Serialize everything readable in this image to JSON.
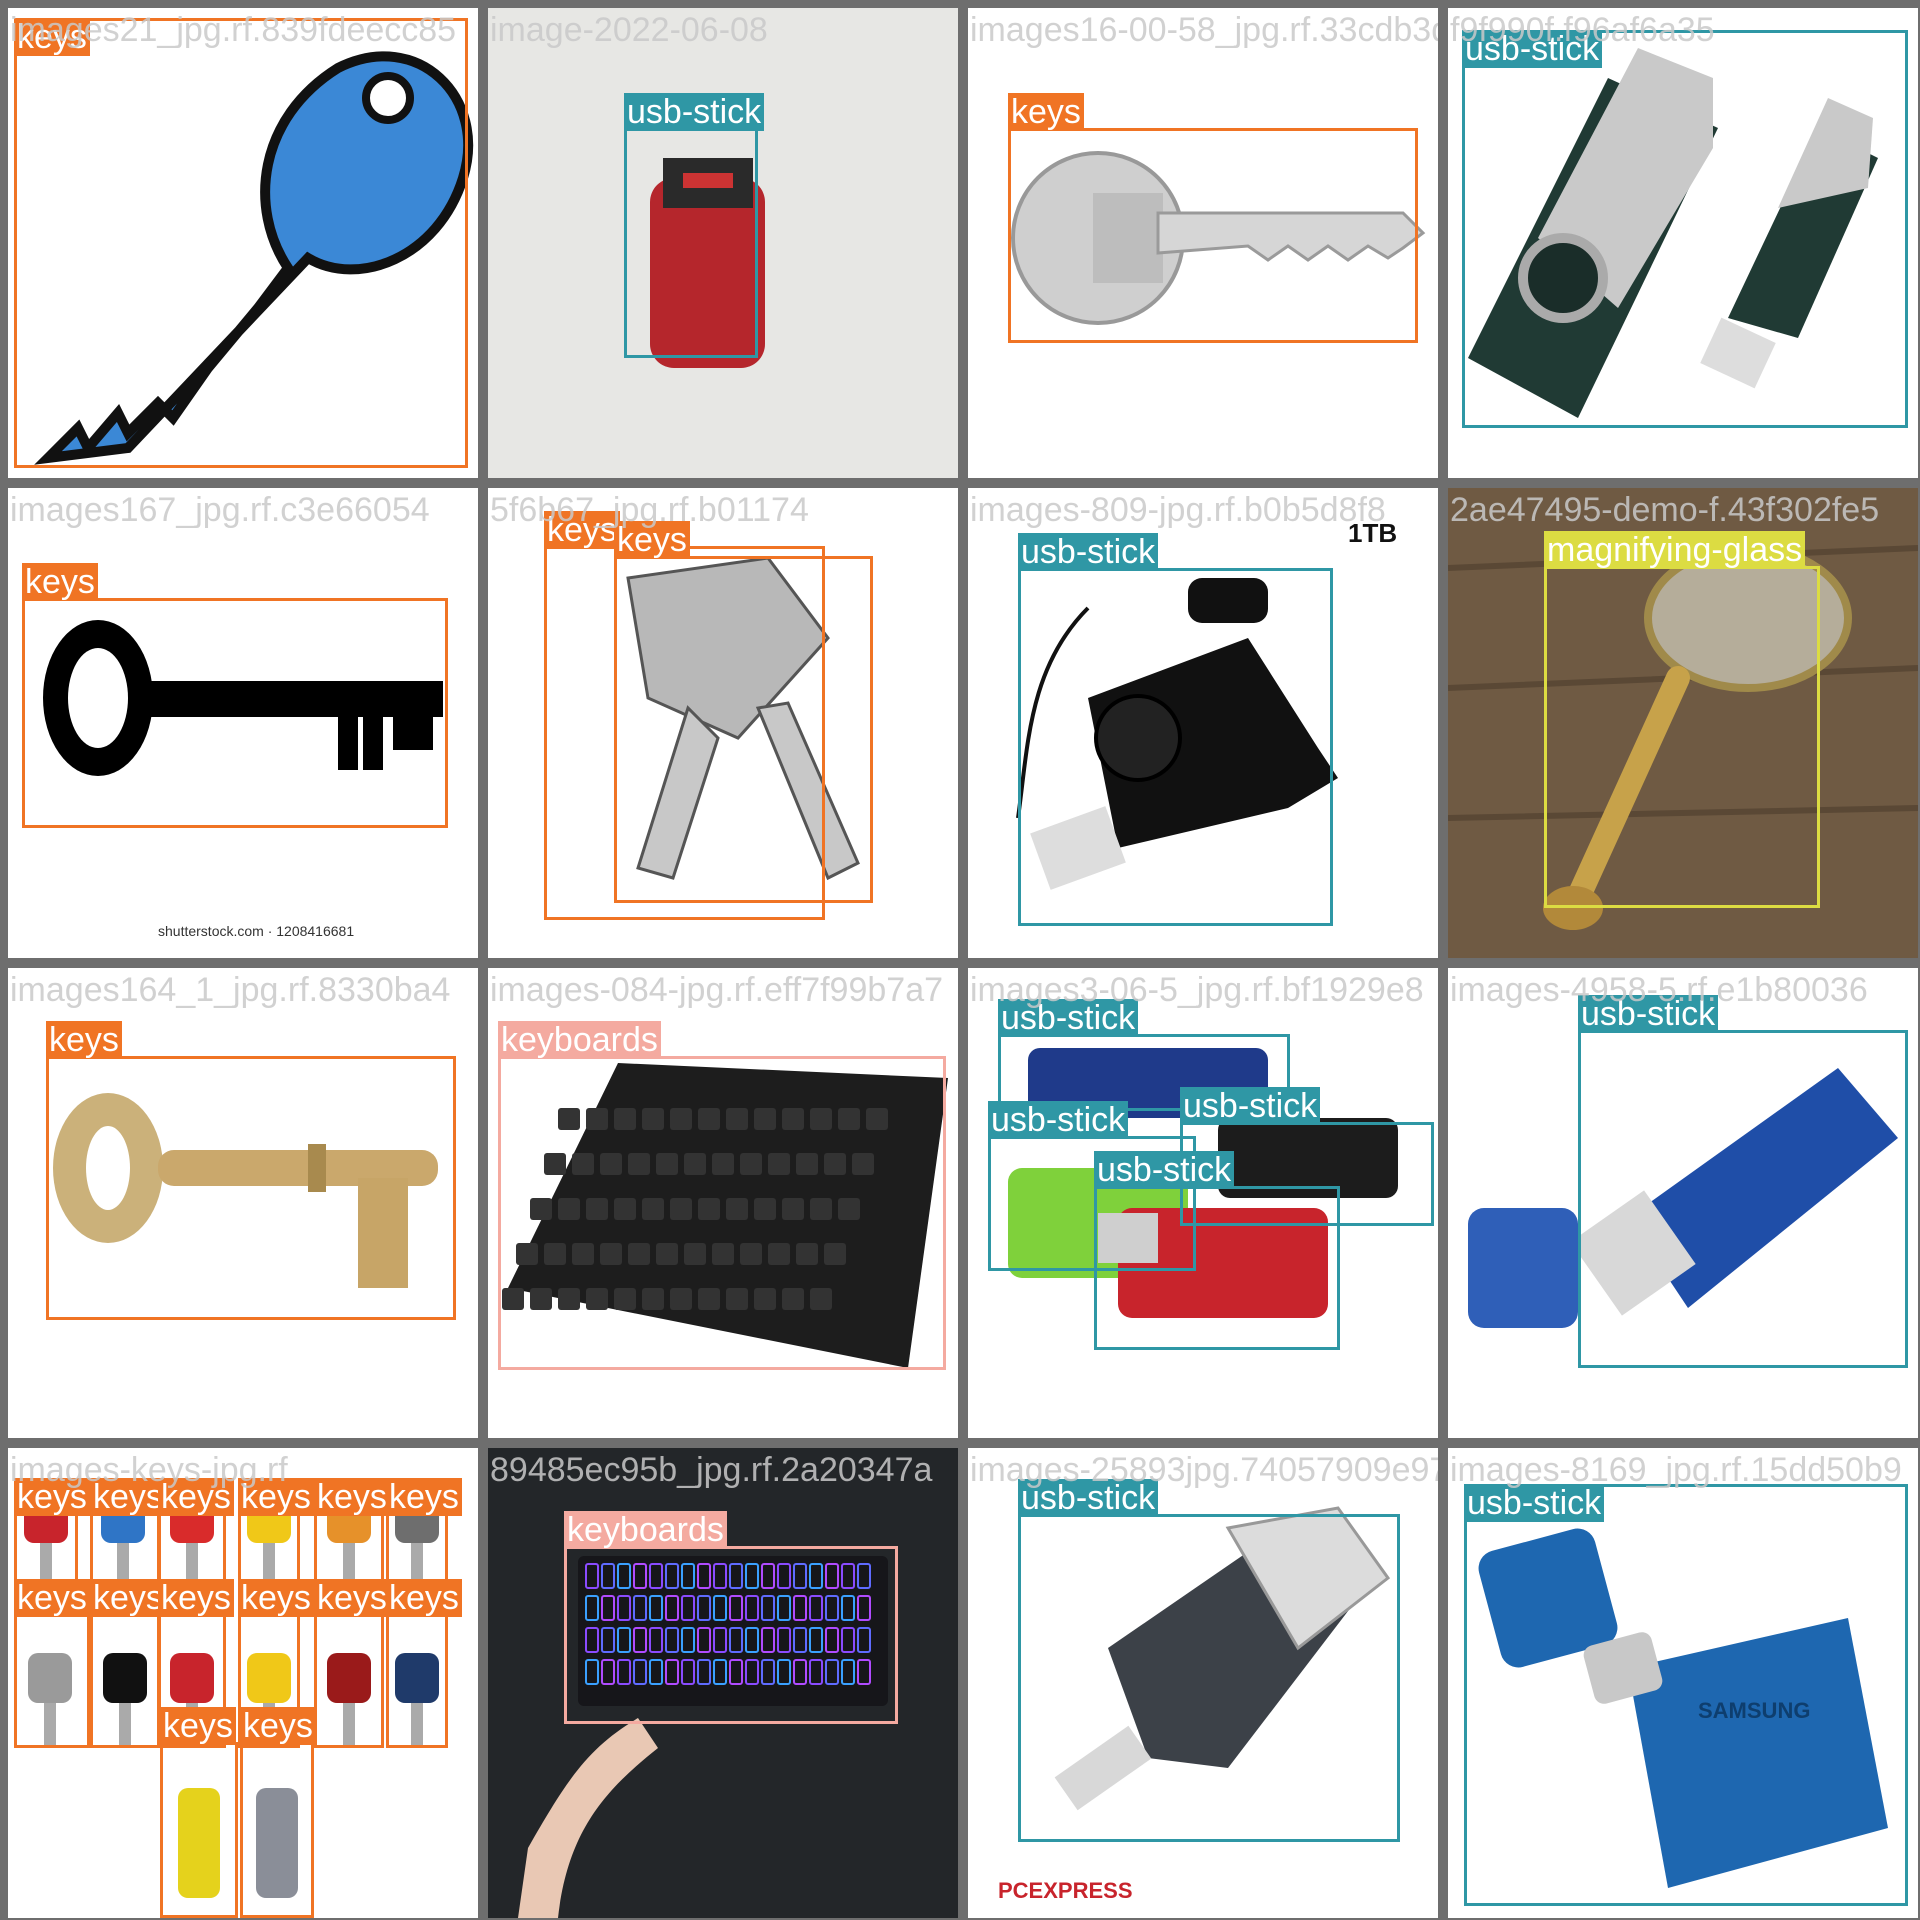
{
  "colors": {
    "keys": "#f07424",
    "usb-stick": "#2f97a5",
    "magnifying-glass": "#dcdc42",
    "keyboards": "#f4aaa0",
    "separator": "#6e6e6e"
  },
  "tiles": [
    {
      "name": "images21_jpg.rf.839fdeecc85",
      "bg": "#ffffff",
      "art": "key-blue",
      "boxes": [
        {
          "label": "keys",
          "cls": "keys"
        }
      ]
    },
    {
      "name": "image-2022-06-08",
      "bg": "#e7e7e4",
      "art": "usb-red",
      "boxes": [
        {
          "label": "usb-stick",
          "cls": "usb-stick"
        }
      ]
    },
    {
      "name": "images16-00-58_jpg.rf.33cdb3d",
      "bg": "#ffffff",
      "art": "key-silver",
      "boxes": [
        {
          "label": "keys",
          "cls": "keys"
        }
      ]
    },
    {
      "name": "f9f990f.f96af6a35",
      "bg": "#ffffff",
      "art": "usb-swivel",
      "boxes": [
        {
          "label": "usb-stick",
          "cls": "usb-stick"
        }
      ]
    },
    {
      "name": "images167_jpg.rf.c3e66054",
      "bg": "#ffffff",
      "art": "key-black",
      "extra": "shutterstock.com · 1208416681",
      "boxes": [
        {
          "label": "keys",
          "cls": "keys"
        }
      ]
    },
    {
      "name": "5f6b67_jpg.rf.b01174",
      "bg": "#ffffff",
      "art": "key-pair",
      "boxes": [
        {
          "label": "keys",
          "cls": "keys"
        },
        {
          "label": "keys",
          "cls": "keys"
        }
      ]
    },
    {
      "name": "images-809-jpg.rf.b0b5d8f8",
      "bg": "#ffffff",
      "art": "usb-sandisk",
      "extra": "1TB",
      "boxes": [
        {
          "label": "usb-stick",
          "cls": "usb-stick"
        }
      ]
    },
    {
      "name": "2ae47495-demo-f.43f302fe5",
      "bg": "#6f5a43",
      "art": "magnifier",
      "boxes": [
        {
          "label": "magnifying-glass",
          "cls": "magnifying-glass"
        }
      ]
    },
    {
      "name": "images164_1_jpg.rf.8330ba4",
      "bg": "#ffffff",
      "art": "key-brass",
      "boxes": [
        {
          "label": "keys",
          "cls": "keys"
        }
      ]
    },
    {
      "name": "images-084-jpg.rf.eff7f99b7a7",
      "bg": "#ffffff",
      "art": "keyboard-black",
      "boxes": [
        {
          "label": "keyboards",
          "cls": "keyboards"
        }
      ]
    },
    {
      "name": "images3-06-5_jpg.rf.bf1929e8",
      "bg": "#ffffff",
      "art": "usb-verbatim",
      "boxes": [
        {
          "label": "usb-stick",
          "cls": "usb-stick"
        },
        {
          "label": "usb-stick",
          "cls": "usb-stick"
        },
        {
          "label": "usb-stick",
          "cls": "usb-stick"
        },
        {
          "label": "usb-stick",
          "cls": "usb-stick"
        }
      ]
    },
    {
      "name": "images-4958-5.rf.e1b80036",
      "bg": "#ffffff",
      "art": "usb-blue",
      "boxes": [
        {
          "label": "usb-stick",
          "cls": "usb-stick"
        }
      ]
    },
    {
      "name": "images-keys-jpg.rf",
      "bg": "#ffffff",
      "art": "key-set",
      "boxes": [
        {
          "label": "keys",
          "cls": "keys"
        },
        {
          "label": "keys",
          "cls": "keys"
        },
        {
          "label": "keys",
          "cls": "keys"
        },
        {
          "label": "keys",
          "cls": "keys"
        },
        {
          "label": "keys",
          "cls": "keys"
        },
        {
          "label": "keys",
          "cls": "keys"
        },
        {
          "label": "keys",
          "cls": "keys"
        },
        {
          "label": "keys",
          "cls": "keys"
        },
        {
          "label": "keys",
          "cls": "keys"
        },
        {
          "label": "keys",
          "cls": "keys"
        },
        {
          "label": "keys",
          "cls": "keys"
        },
        {
          "label": "keys",
          "cls": "keys"
        },
        {
          "label": "keys",
          "cls": "keys"
        },
        {
          "label": "keys",
          "cls": "keys"
        }
      ]
    },
    {
      "name": "89485ec95b_jpg.rf.2a20347a",
      "bg": "#232629",
      "art": "keyboard-rgb",
      "boxes": [
        {
          "label": "keyboards",
          "cls": "keyboards"
        }
      ]
    },
    {
      "name": "images-25893jpg.74057909e97",
      "bg": "#ffffff",
      "art": "usb-otg",
      "extra": "PCEXPRESS",
      "boxes": [
        {
          "label": "usb-stick",
          "cls": "usb-stick"
        }
      ]
    },
    {
      "name": "images-8169_jpg.rf.15dd50b9",
      "bg": "#ffffff",
      "art": "usb-samsung",
      "extra": "SAMSUNG",
      "boxes": [
        {
          "label": "usb-stick",
          "cls": "usb-stick"
        }
      ]
    }
  ]
}
